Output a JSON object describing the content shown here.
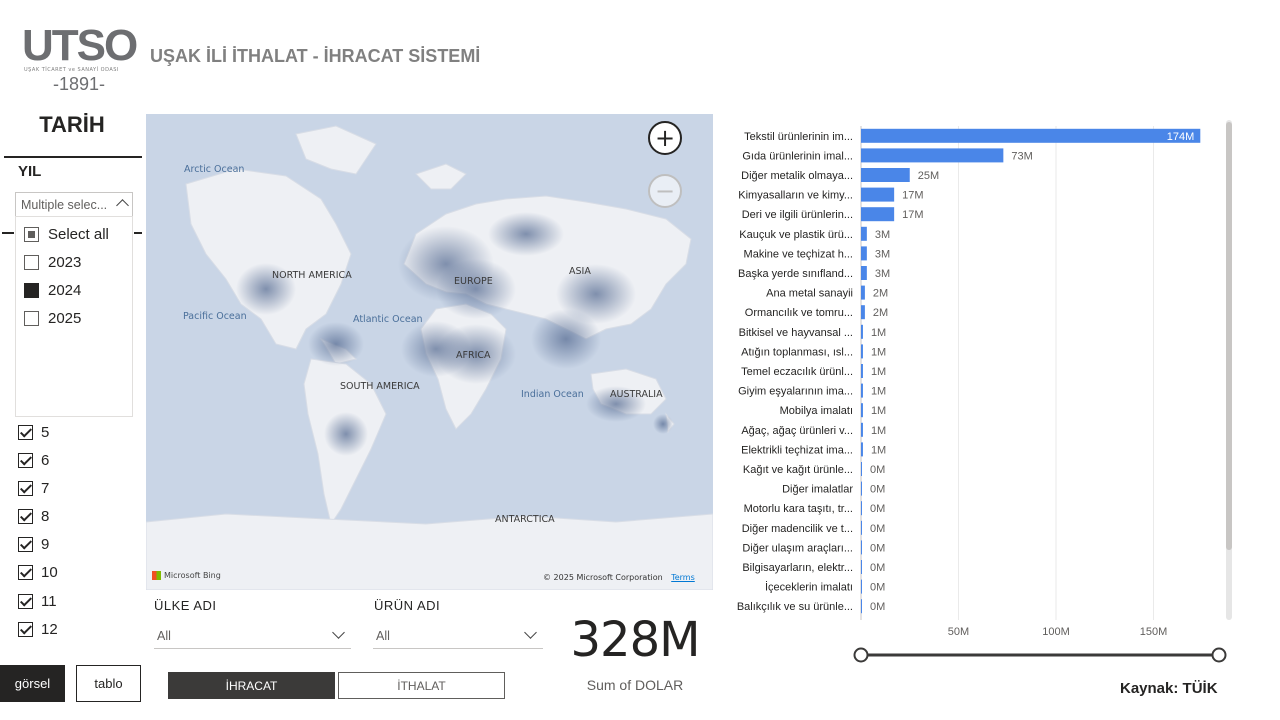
{
  "header": {
    "logo_text": "UTSO",
    "logo_subtext": "UŞAK TİCARET ve SANAYİ ODASI",
    "logo_year": "-1891-",
    "title": "UŞAK İLİ İTHALAT - İHRACAT SİSTEMİ"
  },
  "date_filter": {
    "title": "TARİH",
    "year_label": "YIL",
    "year_dropdown_value": "Multiple selec...",
    "year_options": [
      {
        "label": "Select all",
        "state": "partial"
      },
      {
        "label": "2023",
        "state": "unchecked"
      },
      {
        "label": "2024",
        "state": "checked"
      },
      {
        "label": "2025",
        "state": "unchecked"
      }
    ],
    "months": [
      "5",
      "6",
      "7",
      "8",
      "9",
      "10",
      "11",
      "12"
    ]
  },
  "view_buttons": {
    "gorsel": "görsel",
    "tablo": "tablo"
  },
  "flow_buttons": {
    "ihracat": "İHRACAT",
    "ithalat": "İTHALAT"
  },
  "map": {
    "labels": {
      "arctic": "Arctic Ocean",
      "north_america": "NORTH AMERICA",
      "europe": "EUROPE",
      "asia": "ASIA",
      "pacific": "Pacific Ocean",
      "atlantic": "Atlantic Ocean",
      "africa": "AFRICA",
      "south_america": "SOUTH AMERICA",
      "indian": "Indian Ocean",
      "australia": "AUSTRALIA",
      "antarctica": "ANTARCTICA"
    },
    "zoom_in": "+",
    "zoom_out": "−",
    "attribution": "Microsoft Bing",
    "copyright": "© 2025 Microsoft Corporation",
    "terms": "Terms"
  },
  "filters": {
    "country_label": "ÜLKE ADI",
    "country_value": "All",
    "product_label": "ÜRÜN ADI",
    "product_value": "All"
  },
  "kpi": {
    "value": "328M",
    "label": "Sum of DOLAR"
  },
  "chart_data": {
    "type": "bar",
    "orientation": "horizontal",
    "categories": [
      "Tekstil ürünlerinin im...",
      "Gıda ürünlerinin imal...",
      "Diğer metalik olmaya...",
      "Kimyasalların ve kimy...",
      "Deri ve ilgili ürünlerin...",
      "Kauçuk ve plastik ürü...",
      "Makine ve teçhizat h...",
      "Başka yerde sınıfland...",
      "Ana metal sanayii",
      "Ormancılık ve tomru...",
      "Bitkisel ve hayvansal ...",
      "Atığın toplanması, ısl...",
      "Temel eczacılık ürünl...",
      "Giyim eşyalarının ima...",
      "Mobilya imalatı",
      "Ağaç, ağaç ürünleri v...",
      "Elektrikli teçhizat ima...",
      "Kağıt ve kağıt ürünle...",
      "Diğer imalatlar",
      "Motorlu kara taşıtı, tr...",
      "Diğer madencilik ve t...",
      "Diğer ulaşım araçları...",
      "Bilgisayarların, elektr...",
      "İçeceklerin imalatı",
      "Balıkçılık ve su ürünle..."
    ],
    "values": [
      174,
      73,
      25,
      17,
      17,
      3,
      3,
      3,
      2,
      2,
      1,
      1,
      1,
      1,
      1,
      1,
      1,
      0.3,
      0.2,
      0.2,
      0.1,
      0.1,
      0.1,
      0.05,
      0.02
    ],
    "data_labels": [
      "174M",
      "73M",
      "25M",
      "17M",
      "17M",
      "3M",
      "3M",
      "3M",
      "2M",
      "2M",
      "1M",
      "1M",
      "1M",
      "1M",
      "1M",
      "1M",
      "1M",
      "0M",
      "0M",
      "0M",
      "0M",
      "0M",
      "0M",
      "0M",
      "0M"
    ],
    "x_ticks": [
      "50M",
      "100M",
      "150M"
    ],
    "x_tick_values": [
      50,
      100,
      150
    ],
    "xlim": [
      0,
      180
    ],
    "unit": "M",
    "bar_color": "#4a86e8",
    "grid": true
  },
  "source": "Kaynak: TÜİK"
}
